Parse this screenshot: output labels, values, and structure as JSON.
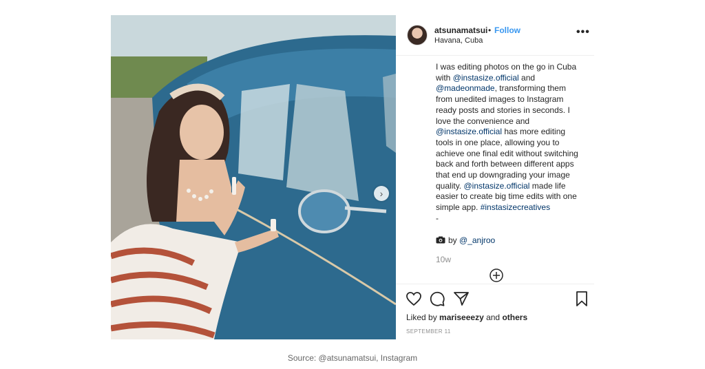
{
  "post": {
    "username": "atsunamatsui",
    "separator": "•",
    "follow_label": "Follow",
    "location": "Havana, Cuba",
    "more_label": "•••",
    "caption": [
      {
        "type": "text",
        "value": "I was editing photos on the go in Cuba with "
      },
      {
        "type": "link",
        "value": "@instasize.official"
      },
      {
        "type": "text",
        "value": " and "
      },
      {
        "type": "link",
        "value": "@madeonmade"
      },
      {
        "type": "text",
        "value": ", transforming them from unedited images to Instagram ready posts and stories in seconds. I love the convenience and "
      },
      {
        "type": "link",
        "value": "@instasize.official"
      },
      {
        "type": "text",
        "value": " has more editing tools in one place, allowing you to achieve one final edit without switching back and forth between different apps that end up downgrading your image quality. "
      },
      {
        "type": "link",
        "value": "@instasize.official"
      },
      {
        "type": "text",
        "value": " made life easier to create big time edits with one simple app. "
      },
      {
        "type": "link",
        "value": "#instasizecreatives"
      },
      {
        "type": "text",
        "value": "\n-"
      }
    ],
    "credit_prefix": "by ",
    "credit_user": "@_anjroo",
    "time_ago": "10w",
    "liked_prefix": "Liked by ",
    "liked_user": "mariseeezy",
    "liked_and": " and ",
    "liked_others": "others",
    "date": "SEPTEMBER 11"
  },
  "icons": {
    "carousel_next": "chevron-right-icon",
    "camera": "camera-icon",
    "load_more": "plus-circle-icon",
    "like": "heart-icon",
    "comment": "comment-icon",
    "share": "share-icon",
    "save": "bookmark-icon"
  },
  "colors": {
    "link": "#003569",
    "follow": "#3897f0",
    "muted": "#8e8e8e",
    "car_blue": "#2f6f94"
  },
  "footer": {
    "source": "Source: @atsunamatsui, Instagram"
  }
}
